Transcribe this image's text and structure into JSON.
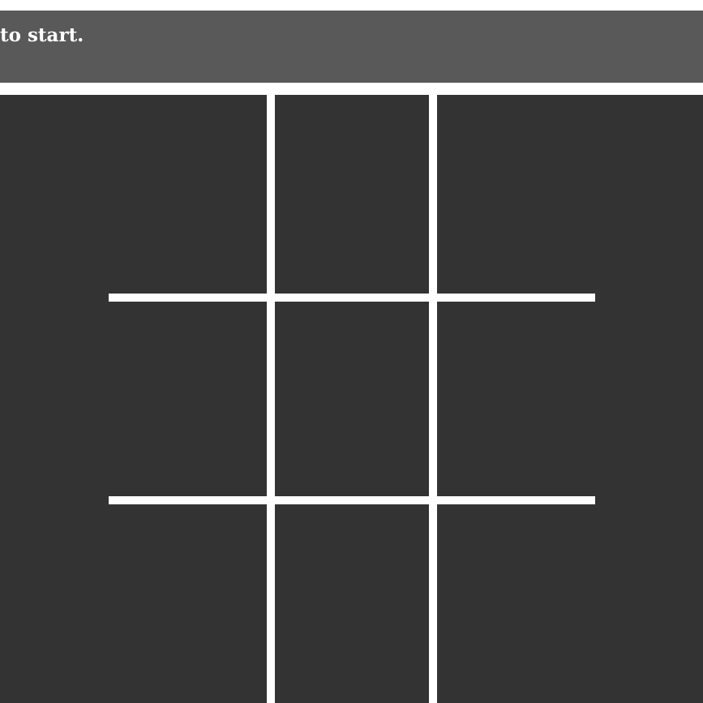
{
  "status": {
    "message": "to start."
  },
  "board": {
    "rows": 3,
    "cols": 3,
    "cells": [
      [
        "",
        "",
        ""
      ],
      [
        "",
        "",
        ""
      ],
      [
        "",
        "",
        ""
      ]
    ]
  },
  "colors": {
    "status_bar": "#595959",
    "board_background": "#333333",
    "grid_lines": "#ffffff",
    "text": "#ffffff"
  }
}
